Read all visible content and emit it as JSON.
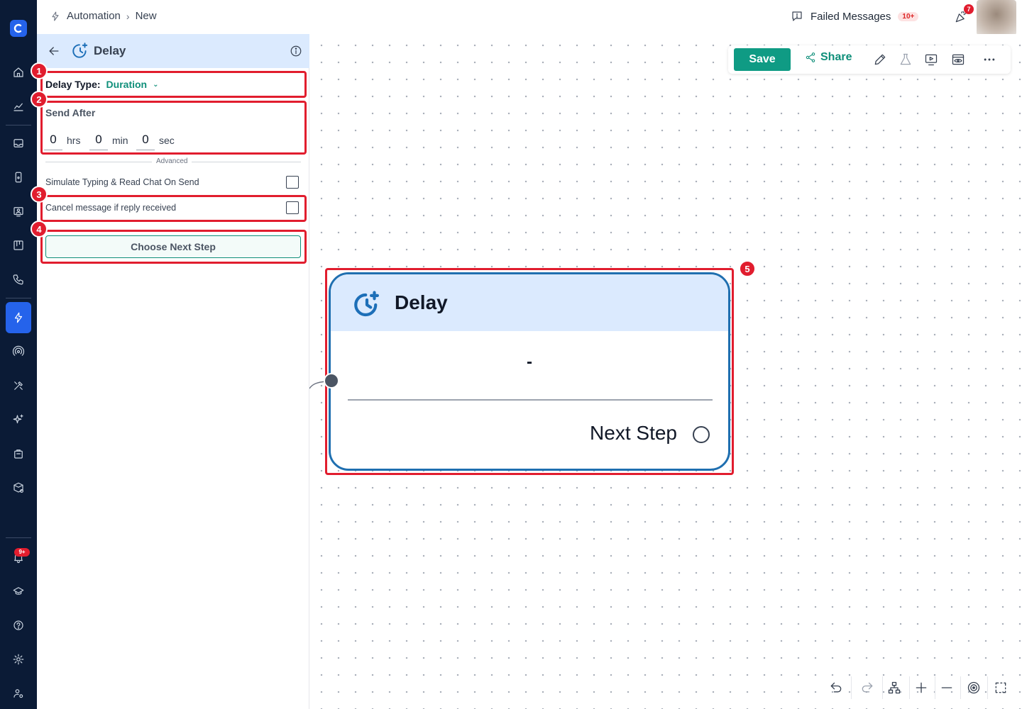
{
  "breadcrumb": {
    "root": "Automation",
    "current": "New"
  },
  "topbar": {
    "failed_label": "Failed Messages",
    "failed_count": "10+",
    "notif_count": "7"
  },
  "rail": {
    "notif_badge": "9+"
  },
  "panel": {
    "title": "Delay",
    "delay_type_label": "Delay Type:",
    "delay_type_value": "Duration",
    "send_after_label": "Send After",
    "hrs_value": "0",
    "hrs_unit": "hrs",
    "min_value": "0",
    "min_unit": "min",
    "sec_value": "0",
    "sec_unit": "sec",
    "advanced_label": "Advanced",
    "simulate_label": "Simulate Typing & Read Chat On Send",
    "cancel_label": "Cancel message if reply received",
    "next_step_btn": "Choose Next Step"
  },
  "markers": [
    "1",
    "2",
    "3",
    "4",
    "5"
  ],
  "toolbar": {
    "save": "Save",
    "share": "Share"
  },
  "node": {
    "title": "Delay",
    "value": "-",
    "next_step": "Next Step"
  },
  "colors": {
    "accent": "#0f9b84",
    "node_border": "#1f6fb0",
    "header_bg": "#dbeafe",
    "rail_bg": "#0b1b36",
    "highlight": "#e11d2e"
  }
}
